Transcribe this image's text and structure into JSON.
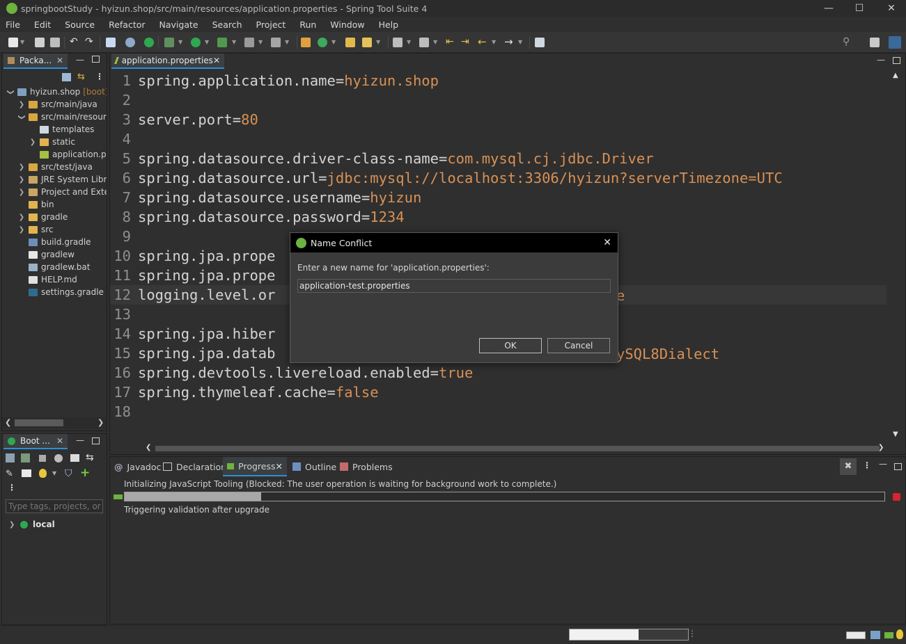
{
  "window": {
    "title": "springbootStudy - hyizun.shop/src/main/resources/application.properties - Spring Tool Suite 4",
    "controls": [
      "—",
      "☐",
      "✕"
    ]
  },
  "menu": [
    "File",
    "Edit",
    "Source",
    "Refactor",
    "Navigate",
    "Search",
    "Project",
    "Run",
    "Window",
    "Help"
  ],
  "explorer": {
    "tab_label": "Packa...",
    "items": [
      {
        "label": "hyizun.shop",
        "suffix": "[boot] [",
        "level": 0,
        "chev": "v",
        "icon": "project-icon"
      },
      {
        "label": "src/main/java",
        "level": 1,
        "chev": ">",
        "icon": "source-folder-icon"
      },
      {
        "label": "src/main/resource",
        "level": 1,
        "chev": "v",
        "icon": "source-folder-icon"
      },
      {
        "label": "templates",
        "level": 2,
        "chev": "",
        "icon": "package-icon"
      },
      {
        "label": "static",
        "level": 2,
        "chev": ">",
        "icon": "folder-icon"
      },
      {
        "label": "application.pro",
        "level": 2,
        "chev": "",
        "icon": "properties-file-icon"
      },
      {
        "label": "src/test/java",
        "level": 1,
        "chev": ">",
        "icon": "source-folder-icon"
      },
      {
        "label": "JRE System Librar",
        "level": 1,
        "chev": ">",
        "icon": "library-icon"
      },
      {
        "label": "Project and Exter",
        "level": 1,
        "chev": ">",
        "icon": "library-icon"
      },
      {
        "label": "bin",
        "level": 1,
        "chev": "",
        "icon": "folder-icon"
      },
      {
        "label": "gradle",
        "level": 1,
        "chev": ">",
        "icon": "folder-icon"
      },
      {
        "label": "src",
        "level": 1,
        "chev": ">",
        "icon": "folder-icon"
      },
      {
        "label": "build.gradle",
        "level": 1,
        "chev": "",
        "icon": "gradle-file-icon"
      },
      {
        "label": "gradlew",
        "level": 1,
        "chev": "",
        "icon": "file-icon"
      },
      {
        "label": "gradlew.bat",
        "level": 1,
        "chev": "",
        "icon": "bat-file-icon"
      },
      {
        "label": "HELP.md",
        "level": 1,
        "chev": "",
        "icon": "markdown-file-icon"
      },
      {
        "label": "settings.gradle",
        "level": 1,
        "chev": "",
        "icon": "gradle-settings-icon"
      }
    ]
  },
  "boot_dashboard": {
    "tab_label": "Boot ...",
    "filter_placeholder": "Type tags, projects, or wo",
    "items": [
      {
        "label": "local"
      }
    ]
  },
  "editor": {
    "tab_label": "application.properties",
    "lines": [
      {
        "n": "1",
        "key": "spring.application.name=",
        "val": "hyizun.shop"
      },
      {
        "n": "2",
        "key": "",
        "val": ""
      },
      {
        "n": "3",
        "key": "server.port=",
        "val": "80"
      },
      {
        "n": "4",
        "key": "",
        "val": ""
      },
      {
        "n": "5",
        "key": "spring.datasource.driver-class-name=",
        "val": "com.mysql.cj.jdbc.Driver"
      },
      {
        "n": "6",
        "key": "spring.datasource.url=",
        "val": "jdbc:mysql://localhost:3306/hyizun?serverTimezone=UTC"
      },
      {
        "n": "7",
        "key": "spring.datasource.username=",
        "val": "hyizun"
      },
      {
        "n": "8",
        "key": "spring.datasource.password=",
        "val": "1234"
      },
      {
        "n": "9",
        "key": "",
        "val": ""
      },
      {
        "n": "10",
        "key": "spring.jpa.prope",
        "val": ""
      },
      {
        "n": "11",
        "key": "spring.jpa.prope",
        "val": ""
      },
      {
        "n": "12",
        "key": "logging.level.or",
        "val": "",
        "tail": "e"
      },
      {
        "n": "13",
        "key": "",
        "val": ""
      },
      {
        "n": "14",
        "key": "spring.jpa.hiber",
        "val": ""
      },
      {
        "n": "15",
        "key": "spring.jpa.datab",
        "val": "",
        "tail": "ySQL8Dialect"
      },
      {
        "n": "16",
        "key": "spring.devtools.livereload.enabled=",
        "val": "true"
      },
      {
        "n": "17",
        "key": "spring.thymeleaf.cache=",
        "val": "false"
      },
      {
        "n": "18",
        "key": "",
        "val": ""
      }
    ]
  },
  "dialog": {
    "title": "Name Conflict",
    "prompt": "Enter a new name for 'application.properties':",
    "input_value": "application-test.properties",
    "ok_label": "OK",
    "cancel_label": "Cancel"
  },
  "bottom_panel": {
    "tabs": [
      "Javadoc",
      "Declaration",
      "Progress",
      "Outline",
      "Problems"
    ],
    "active_tab": "Progress",
    "progress_task": "Initializing JavaScript Tooling (Blocked: The user operation is waiting for background work to complete.)",
    "progress_fraction": 0.18,
    "progress_subtask": "Triggering validation after upgrade"
  },
  "status_bar": {
    "progress_fraction": 0.58
  },
  "colors": {
    "accent_blue": "#2d8fd5",
    "property_value": "#d99155",
    "spring_green": "#6db33f",
    "stop_red": "#d9232e"
  }
}
